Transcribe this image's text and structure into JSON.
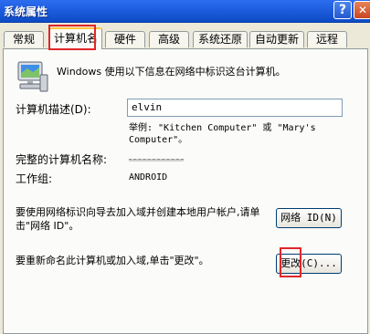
{
  "window": {
    "title": "系统属性",
    "help_label": "?",
    "close_label": "✕"
  },
  "tabs": [
    {
      "label": "常规",
      "active": false
    },
    {
      "label": "计算机名",
      "active": true
    },
    {
      "label": "硬件",
      "active": false
    },
    {
      "label": "高级",
      "active": false
    },
    {
      "label": "系统还原",
      "active": false
    },
    {
      "label": "自动更新",
      "active": false
    },
    {
      "label": "远程",
      "active": false
    }
  ],
  "intro": "Windows 使用以下信息在网络中标识这台计算机。",
  "computer_description": {
    "label": "计算机描述(D):",
    "value": "elvin",
    "example": "举例: \"Kitchen Computer\" 或 \"Mary's Computer\"。"
  },
  "full_name": {
    "label": "完整的计算机名称:",
    "value": ""
  },
  "workgroup": {
    "label": "工作组:",
    "value": "ANDROID"
  },
  "network_id": {
    "text": "要使用网络标识向导去加入域并创建本地用户帐户,请单击\"网络 ID\"。",
    "button_label": "网络 ID(N)"
  },
  "rename": {
    "text": "要重新命名此计算机或加入域,单击\"更改\"。",
    "button_label": "更改(C)..."
  },
  "colors": {
    "title_bar": "#1f5fe0",
    "highlight": "#e1262a",
    "dialog_bg": "#ece9d8"
  },
  "icons": [
    "computer-icon",
    "help-icon",
    "close-icon"
  ]
}
